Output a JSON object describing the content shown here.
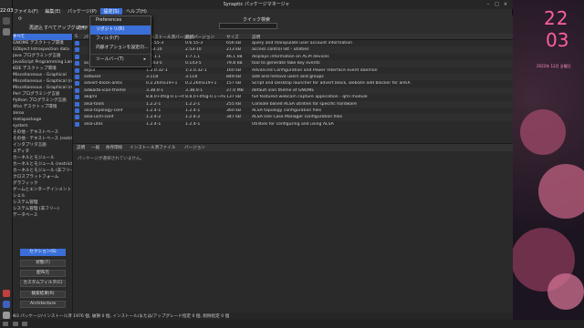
{
  "window": {
    "title": "Synaptic パッケージマネージャ"
  },
  "clock": "22:03",
  "desktop": {
    "date_top": "22",
    "date_bottom": "03",
    "date_sub": "2022年 12月 全曜日"
  },
  "menubar": [
    "ファイル(F)",
    "編集(E)",
    "パッケージ(P)",
    "設定(S)",
    "ヘルプ(H)"
  ],
  "toolbar": {
    "reload": "再読込",
    "mark_upgrades": "すべてアップグレード",
    "apply": "適用",
    "quick_search": "クイック検索"
  },
  "settings_menu": {
    "items": [
      {
        "label": "Preferences"
      },
      {
        "label": "リポジトリ(R)"
      },
      {
        "label": "フィルタ(F)"
      },
      {
        "label": "内部オプションを設定(I)..."
      },
      {
        "label": "ツールバー(T)",
        "submenu": true
      }
    ]
  },
  "categories": [
    "すべて",
    "GNOME デスクトップ環境",
    "GObject Introspection data",
    "Java プログラミング言語",
    "JavaScript Programming Language",
    "KDE デスクトップ環境",
    "Miscellaneous - Graphical",
    "Miscellaneous - Graphical (non)",
    "Miscellaneous - Graphical (m)",
    "Perl プログラミング言語",
    "Python プログラミング言語",
    "Xfce デスクトップ環境",
    "zerox",
    "metapackage",
    "system",
    "その他 - テキストベース",
    "その他 - テキストベース (restricted)",
    "インタプリタ言語",
    "エディタ",
    "カーネルとモジュール",
    "カーネルとモジュール (restricted)",
    "カーネルとモジュール (非フリー)",
    "クロスプラットフォーム",
    "グラフィック",
    "ゲームとエンターテインメント",
    "シェル",
    "システム管理",
    "システム管理 (非フリー)",
    "データベース"
  ],
  "left_buttons": [
    "セクション(S)",
    "状態(T)",
    "配布元",
    "カスタムフィルタ(C)",
    "検索結果(R)",
    "Architecture"
  ],
  "table": {
    "headers": [
      "S",
      "パッケージ名",
      "インストール済バージョン",
      "最新バージョン",
      "サイズ",
      "説明"
    ],
    "rows": [
      {
        "name": "",
        "inst": "0.6.55-3",
        "latest": "0.6.55-3",
        "size": "656 kB",
        "desc": "query and manipulate user account information"
      },
      {
        "name": "",
        "inst": "2.53.10",
        "latest": "2.53-10",
        "size": "213 kB",
        "desc": "access control list - utilities"
      },
      {
        "name": "",
        "inst": "1:7.1.1",
        "latest": "1:7.1.1",
        "size": "46.1 kB",
        "desc": "displays information on ACPI devices"
      },
      {
        "name": "acpi-fakekey",
        "inst": "0.143-5",
        "latest": "0.143-5",
        "size": "79.8 kB",
        "desc": "tool to generate fake key events"
      },
      {
        "name": "acpid",
        "inst": "1:2.0.32-1",
        "latest": "1:2.0.32-1",
        "size": "160 kB",
        "desc": "Advanced Configuration and Power Interface event daemon"
      },
      {
        "name": "adduser",
        "inst": "3.118",
        "latest": "3.118",
        "size": "849 kB",
        "desc": "add and remove users and groups"
      },
      {
        "name": "advert-block-antix",
        "inst": "0.2.26mx19+1",
        "latest": "0.2.26mx19+1",
        "size": "157 kB",
        "desc": "Script and Desktop launcher for advert block, website add blocker for antiX."
      },
      {
        "name": "adwaita-icon-theme",
        "inst": "3.38.0-1",
        "latest": "3.38.0-1",
        "size": "27.0 MB",
        "desc": "default icon theme of GNOME"
      },
      {
        "name": "akqml",
        "inst": "8.8.0+dfsg-0.1~mx",
        "latest": "8.8.0+dfsg-0.1~mx",
        "size": "137 kB",
        "desc": "full featured webcam capture application - qml module"
      },
      {
        "name": "alsa-tools",
        "inst": "1.2.2-1",
        "latest": "1.2.2-1",
        "size": "255 kB",
        "desc": "Console based ALSA utilities for specific hardware"
      },
      {
        "name": "alsa-topology-conf",
        "inst": "1.2.4-1",
        "latest": "1.2.4-1",
        "size": "360 kB",
        "desc": "ALSA topology configuration files"
      },
      {
        "name": "alsa-ucm-conf",
        "inst": "1.2.4-2",
        "latest": "1.2.4-2",
        "size": "347 kB",
        "desc": "ALSA Use Case Manager configuration files"
      },
      {
        "name": "alsa-utils",
        "inst": "1.2.4-1",
        "latest": "1.2.4-1",
        "size": "",
        "desc": "Utilities for configuring and using ALSA"
      }
    ]
  },
  "desc_tabs": [
    "説明",
    "一般",
    "依存関係",
    "インストール済ファイル",
    "バージョン"
  ],
  "desc_message": "パッケージが選択されていません。",
  "status": "全 1983 パッケージ/インストール済 1976 個, 破損 0 個, インストール/または/アップグレード指定 0 個, 削除指定 0 個"
}
